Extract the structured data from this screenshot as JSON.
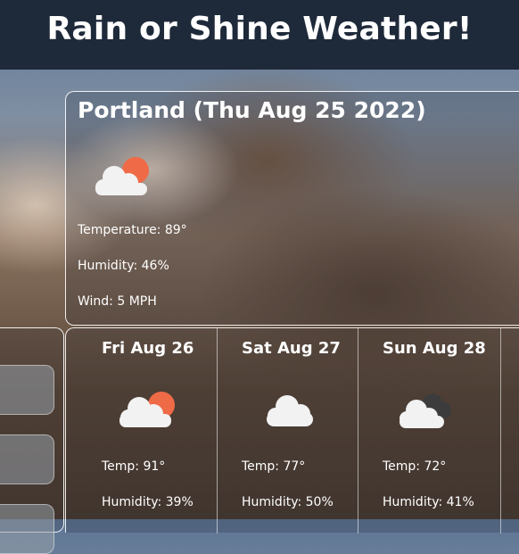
{
  "header": {
    "title": "Rain or Shine Weather!"
  },
  "current": {
    "heading": "Portland (Thu Aug 25 2022)",
    "icon": "partly-sunny-cloud-icon",
    "temperature": "Temperature: 89°",
    "humidity": "Humidity: 46%",
    "wind": "Wind: 5 MPH"
  },
  "forecast": [
    {
      "day": "Fri Aug 26",
      "icon": "partly-sunny-cloud-icon",
      "temp": "Temp: 91°",
      "humidity": "Humidity: 39%"
    },
    {
      "day": "Sat Aug 27",
      "icon": "cloud-icon",
      "temp": "Temp: 77°",
      "humidity": "Humidity: 50%"
    },
    {
      "day": "Sun Aug 28",
      "icon": "dark-clouds-icon",
      "temp": "Temp: 72°",
      "humidity": "Humidity: 41%"
    }
  ],
  "colors": {
    "header_bg": "#1e2a3a",
    "sun": "#ef6b47",
    "cloud": "#f2f2f2",
    "dark_cloud": "#3c3c3c"
  }
}
